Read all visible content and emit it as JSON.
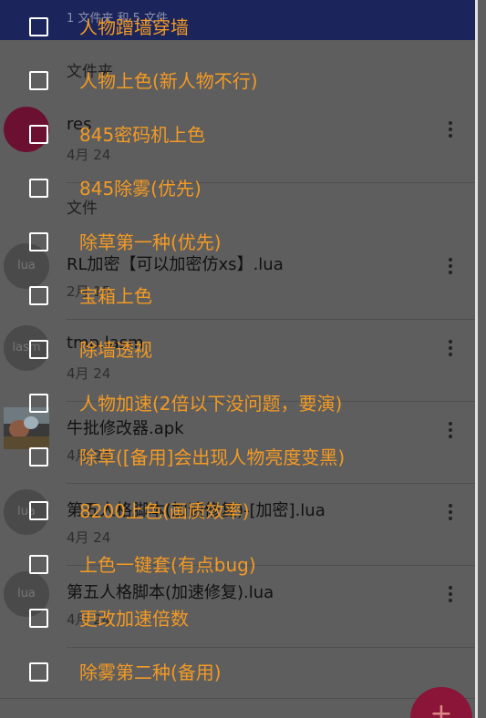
{
  "header": {
    "summary": "1 文件夹 和 5 文件"
  },
  "sections": {
    "folders": "文件夹",
    "files": "文件"
  },
  "folder_rows": [
    {
      "name": "res",
      "date": "4月 24",
      "icon": "folder-icon"
    }
  ],
  "file_rows": [
    {
      "name": "RL加密【可以加密仿xs】.lua",
      "date": "2月 15",
      "icon_text": "lua"
    },
    {
      "name": "tmp.lasm",
      "date": "4月 24",
      "icon_text": "lasm"
    },
    {
      "name": "牛批修改器.apk",
      "date": "4月 24",
      "icon": "apk-thumbnail"
    },
    {
      "name": "第五人格脚本(加速修复)-[加密].lua",
      "date": "4月 24",
      "icon_text": "lua"
    },
    {
      "name": "第五人格脚本(加速修复).lua",
      "date": "4月 24",
      "icon_text": "lua"
    }
  ],
  "fab": {
    "label": "+"
  },
  "checklist": [
    {
      "label": "人物蹭墙穿墙",
      "checked": false
    },
    {
      "label": "人物上色(新人物不行)",
      "checked": false
    },
    {
      "label": "845密码机上色",
      "checked": false
    },
    {
      "label": "845除雾(优先)",
      "checked": false
    },
    {
      "label": "除草第一种(优先)",
      "checked": false
    },
    {
      "label": "宝箱上色",
      "checked": false
    },
    {
      "label": "除墙透视",
      "checked": false
    },
    {
      "label": "人物加速(2倍以下没问题，要演)",
      "checked": false
    },
    {
      "label": "除草([备用]会出现人物亮度变黑)",
      "checked": false
    },
    {
      "label": "8200上色(画质效率)",
      "checked": false
    },
    {
      "label": "上色一键套(有点bug)",
      "checked": false
    },
    {
      "label": "更改加速倍数",
      "checked": false
    },
    {
      "label": "除雾第二种(备用)",
      "checked": false
    }
  ],
  "colors": {
    "overlay_text": "#f39a24",
    "topbar": "#1b255c",
    "fab": "#8a1538"
  }
}
